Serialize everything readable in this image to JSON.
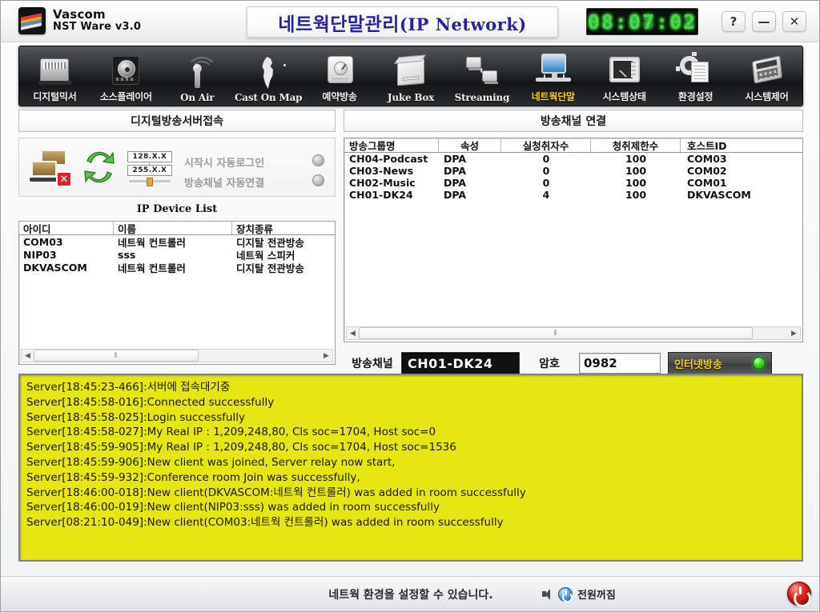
{
  "titlebar": {
    "brand_line1": "Vascom",
    "brand_line2": "NST Ware v3.0",
    "window_title_ko": "네트웍단말관리",
    "window_title_en": "(IP Network)",
    "clock": "08:07:02",
    "help_label": "?",
    "minimize_label": "—",
    "close_label": "✕"
  },
  "toolbar": {
    "items": [
      {
        "label": "디지털믹서",
        "icon": "digital-mixer-icon",
        "active": false
      },
      {
        "label": "소스플레이어",
        "icon": "source-player-icon",
        "active": false
      },
      {
        "label": "On Air",
        "icon": "on-air-antenna-icon",
        "active": false
      },
      {
        "label": "Cast On Map",
        "icon": "korea-map-icon",
        "active": false
      },
      {
        "label": "예약방송",
        "icon": "schedule-knob-icon",
        "active": false
      },
      {
        "label": "Juke Box",
        "icon": "juke-box-icon",
        "active": false
      },
      {
        "label": "Streaming",
        "icon": "streaming-pc-icon",
        "active": false
      },
      {
        "label": "네트웍단말",
        "icon": "network-terminal-icon",
        "active": true
      },
      {
        "label": "시스템상태",
        "icon": "system-status-scope-icon",
        "active": false
      },
      {
        "label": "환경설정",
        "icon": "settings-gear-icon",
        "active": false
      },
      {
        "label": "시스템제어",
        "icon": "system-control-calculator-icon",
        "active": false
      }
    ]
  },
  "left_panel": {
    "header": "디지털방송서버접속",
    "options": [
      {
        "label": "시작시 자동로그인",
        "led": "off"
      },
      {
        "label": "방송채널 자동연결",
        "led": "off"
      }
    ],
    "ip_badge_top": "128.X.X",
    "ip_badge_bottom": "255.X.X",
    "device_list_title": "IP Device List",
    "device_list": {
      "columns": [
        "아이디",
        "이름",
        "장치종류"
      ],
      "rows": [
        [
          "COM03",
          "네트웍 컨트롤러",
          "디지탈 전관방송"
        ],
        [
          "NIP03",
          "sss",
          "네트웍 스피커"
        ],
        [
          "DKVASCOM",
          "네트웍 컨트롤러",
          "디지탈 전관방송"
        ]
      ]
    },
    "scroll_thumb_glyph": "⦀"
  },
  "right_panel": {
    "header": "방송채널 연결",
    "channel_table": {
      "columns": [
        "방송그룹명",
        "속성",
        "실청취자수",
        "청취제한수",
        "호스트ID"
      ],
      "rows": [
        [
          "CH04-Podcast",
          "DPA",
          "0",
          "100",
          "COM03"
        ],
        [
          "CH03-News",
          "DPA",
          "0",
          "100",
          "COM02"
        ],
        [
          "CH02-Music",
          "DPA",
          "0",
          "100",
          "COM01"
        ],
        [
          "CH01-DK24",
          "DPA",
          "4",
          "100",
          "DKVASCOM"
        ]
      ]
    },
    "scroll_thumb_glyph": "⦀",
    "controls": {
      "channel_label": "방송채널",
      "channel_value": "CH01-DK24",
      "password_label": "암호",
      "password_value": "0982",
      "cast_button_label": "인터넷방송",
      "cast_led": "on"
    }
  },
  "log": {
    "lines": [
      "Server[18:45:23-466]:서버에 접속대기중",
      "Server[18:45:58-016]:Connected successfully",
      "Server[18:45:58-025]:Login successfully",
      "Server[18:45:58-027]:My Real IP : 1,209,248,80, Cls soc=1704, Host soc=0",
      "Server[18:45:59-905]:My Real IP : 1,209,248,80, Cls soc=1704, Host soc=1536",
      "Server[18:45:59-906]:New client was joined, Server relay now start,",
      "Server[18:45:59-932]:Conference room Join was successfully,",
      "Server[18:46:00-018]:New client(DKVASCOM:네트웍 컨트롤러) was added in room successfully",
      "Server[18:46:00-019]:New client(NIP03:sss) was added in room successfully",
      "Server[08:21:10-049]:New client(COM03:네트웍 컨트롤러) was added in room successfully"
    ]
  },
  "statusbar": {
    "message": "네트웍 환경을 설정할 수 있습니다.",
    "power_off_label": "전원꺼짐"
  },
  "colors": {
    "log_background": "#e6e612",
    "title_text": "#2323a8",
    "active_tab": "#ffd200",
    "led_on": "#3ddd2a",
    "power_red": "#e8251c"
  }
}
